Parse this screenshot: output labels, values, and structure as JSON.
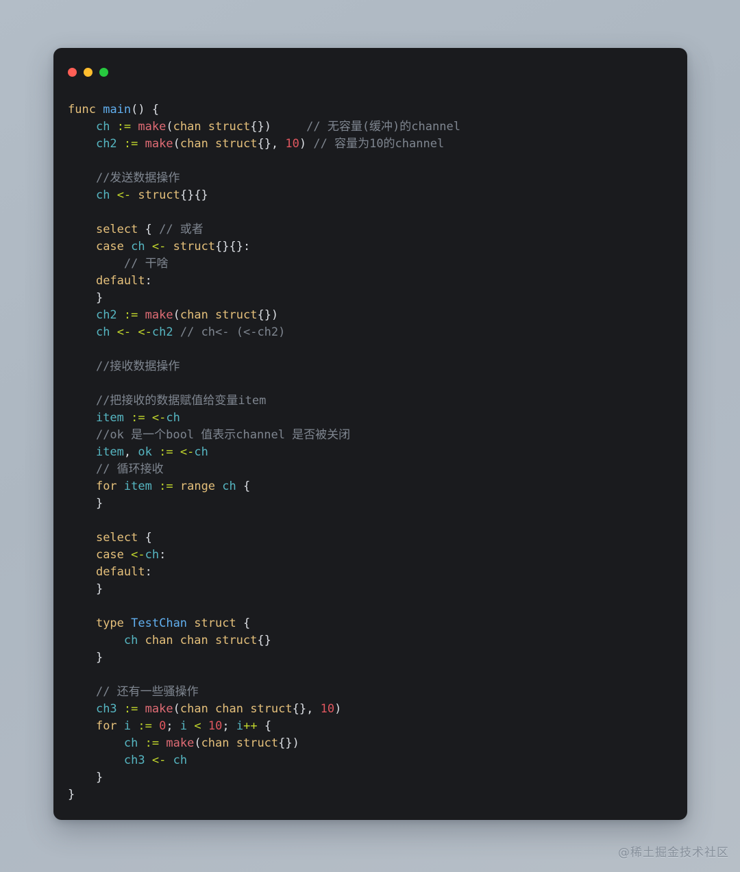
{
  "window": {
    "title_bar": {
      "buttons": [
        {
          "name": "close",
          "color": "#ff5f56",
          "label": ""
        },
        {
          "name": "minimize",
          "color": "#ffbd2e",
          "label": ""
        },
        {
          "name": "maximize",
          "color": "#27c93f",
          "label": ""
        }
      ]
    },
    "background": "#1a1b1e"
  },
  "theme": {
    "keyword": "#e5c07b",
    "function": "#61afef",
    "variable": "#56b6c2",
    "operator": "#c3d82c",
    "builtin": "#e06c75",
    "type": "#e5c07b",
    "number": "#e0575f",
    "punctuation": "#dcdfe4",
    "comment": "#7f8690",
    "page_background": "#b1bbc5"
  },
  "code": {
    "language": "go",
    "lines": [
      {
        "n": 1,
        "text": "func main() {"
      },
      {
        "n": 2,
        "text": "    ch := make(chan struct{})     // 无容量(缓冲)的channel"
      },
      {
        "n": 3,
        "text": "    ch2 := make(chan struct{}, 10) // 容量为10的channel"
      },
      {
        "n": 4,
        "text": ""
      },
      {
        "n": 5,
        "text": "    //发送数据操作"
      },
      {
        "n": 6,
        "text": "    ch <- struct{}{}"
      },
      {
        "n": 7,
        "text": ""
      },
      {
        "n": 8,
        "text": "    select { // 或者"
      },
      {
        "n": 9,
        "text": "    case ch <- struct{}{}:"
      },
      {
        "n": 10,
        "text": "        // 干啥"
      },
      {
        "n": 11,
        "text": "    default:"
      },
      {
        "n": 12,
        "text": "    }"
      },
      {
        "n": 13,
        "text": "    ch2 := make(chan struct{})"
      },
      {
        "n": 14,
        "text": "    ch <- <-ch2 // ch<- (<-ch2)"
      },
      {
        "n": 15,
        "text": ""
      },
      {
        "n": 16,
        "text": "    //接收数据操作"
      },
      {
        "n": 17,
        "text": ""
      },
      {
        "n": 18,
        "text": "    //把接收的数据赋值给变量item"
      },
      {
        "n": 19,
        "text": "    item := <-ch"
      },
      {
        "n": 20,
        "text": "    //ok 是一个bool 值表示channel 是否被关闭"
      },
      {
        "n": 21,
        "text": "    item, ok := <-ch"
      },
      {
        "n": 22,
        "text": "    // 循环接收"
      },
      {
        "n": 23,
        "text": "    for item := range ch {"
      },
      {
        "n": 24,
        "text": "    }"
      },
      {
        "n": 25,
        "text": ""
      },
      {
        "n": 26,
        "text": "    select {"
      },
      {
        "n": 27,
        "text": "    case <-ch:"
      },
      {
        "n": 28,
        "text": "    default:"
      },
      {
        "n": 29,
        "text": "    }"
      },
      {
        "n": 30,
        "text": ""
      },
      {
        "n": 31,
        "text": "    type TestChan struct {"
      },
      {
        "n": 32,
        "text": "        ch chan chan struct{}"
      },
      {
        "n": 33,
        "text": "    }"
      },
      {
        "n": 34,
        "text": ""
      },
      {
        "n": 35,
        "text": "    // 还有一些骚操作"
      },
      {
        "n": 36,
        "text": "    ch3 := make(chan chan struct{}, 10)"
      },
      {
        "n": 37,
        "text": "    for i := 0; i < 10; i++ {"
      },
      {
        "n": 38,
        "text": "        ch := make(chan struct{})"
      },
      {
        "n": 39,
        "text": "        ch3 <- ch"
      },
      {
        "n": 40,
        "text": "    }"
      },
      {
        "n": 41,
        "text": "}"
      }
    ],
    "tokens": {
      "l1": [
        [
          "kw",
          "func"
        ],
        [
          "pun",
          " "
        ],
        [
          "fn",
          "main"
        ],
        [
          "pun",
          "() {"
        ]
      ],
      "l2": [
        [
          "pun",
          "    "
        ],
        [
          "var",
          "ch"
        ],
        [
          "pun",
          " "
        ],
        [
          "op",
          ":="
        ],
        [
          "pun",
          " "
        ],
        [
          "bi",
          "make"
        ],
        [
          "pun",
          "("
        ],
        [
          "ty",
          "chan struct"
        ],
        [
          "pun",
          "{})"
        ],
        [
          "cm",
          "     // 无容量(缓冲)的channel"
        ]
      ],
      "l3": [
        [
          "pun",
          "    "
        ],
        [
          "var",
          "ch2"
        ],
        [
          "pun",
          " "
        ],
        [
          "op",
          ":="
        ],
        [
          "pun",
          " "
        ],
        [
          "bi",
          "make"
        ],
        [
          "pun",
          "("
        ],
        [
          "ty",
          "chan struct"
        ],
        [
          "pun",
          "{}, "
        ],
        [
          "num",
          "10"
        ],
        [
          "pun",
          ")"
        ],
        [
          "cm",
          " // 容量为10的channel"
        ]
      ],
      "l5": [
        [
          "pun",
          "    "
        ],
        [
          "cm",
          "//发送数据操作"
        ]
      ],
      "l6": [
        [
          "pun",
          "    "
        ],
        [
          "var",
          "ch"
        ],
        [
          "pun",
          " "
        ],
        [
          "op",
          "<-"
        ],
        [
          "pun",
          " "
        ],
        [
          "ty",
          "struct"
        ],
        [
          "pun",
          "{}{}"
        ]
      ],
      "l8": [
        [
          "pun",
          "    "
        ],
        [
          "kw",
          "select"
        ],
        [
          "pun",
          " {"
        ],
        [
          "cm",
          " // 或者"
        ]
      ],
      "l9": [
        [
          "pun",
          "    "
        ],
        [
          "kw",
          "case"
        ],
        [
          "pun",
          " "
        ],
        [
          "var",
          "ch"
        ],
        [
          "pun",
          " "
        ],
        [
          "op",
          "<-"
        ],
        [
          "pun",
          " "
        ],
        [
          "ty",
          "struct"
        ],
        [
          "pun",
          "{}{}:"
        ]
      ],
      "l10": [
        [
          "pun",
          "        "
        ],
        [
          "cm",
          "// 干啥"
        ]
      ],
      "l11": [
        [
          "pun",
          "    "
        ],
        [
          "kw",
          "default"
        ],
        [
          "pun",
          ":"
        ]
      ],
      "l12": [
        [
          "pun",
          "    }"
        ]
      ],
      "l13": [
        [
          "pun",
          "    "
        ],
        [
          "var",
          "ch2"
        ],
        [
          "pun",
          " "
        ],
        [
          "op",
          ":="
        ],
        [
          "pun",
          " "
        ],
        [
          "bi",
          "make"
        ],
        [
          "pun",
          "("
        ],
        [
          "ty",
          "chan struct"
        ],
        [
          "pun",
          "{})"
        ]
      ],
      "l14": [
        [
          "pun",
          "    "
        ],
        [
          "var",
          "ch"
        ],
        [
          "pun",
          " "
        ],
        [
          "op",
          "<-"
        ],
        [
          "pun",
          " "
        ],
        [
          "op",
          "<-"
        ],
        [
          "var",
          "ch2"
        ],
        [
          "cm",
          " // ch<- (<-ch2)"
        ]
      ],
      "l16": [
        [
          "pun",
          "    "
        ],
        [
          "cm",
          "//接收数据操作"
        ]
      ],
      "l18": [
        [
          "pun",
          "    "
        ],
        [
          "cm",
          "//把接收的数据赋值给变量item"
        ]
      ],
      "l19": [
        [
          "pun",
          "    "
        ],
        [
          "var",
          "item"
        ],
        [
          "pun",
          " "
        ],
        [
          "op",
          ":="
        ],
        [
          "pun",
          " "
        ],
        [
          "op",
          "<-"
        ],
        [
          "var",
          "ch"
        ]
      ],
      "l20": [
        [
          "pun",
          "    "
        ],
        [
          "cm",
          "//ok 是一个bool 值表示channel 是否被关闭"
        ]
      ],
      "l21": [
        [
          "pun",
          "    "
        ],
        [
          "var",
          "item"
        ],
        [
          "pun",
          ", "
        ],
        [
          "var",
          "ok"
        ],
        [
          "pun",
          " "
        ],
        [
          "op",
          ":="
        ],
        [
          "pun",
          " "
        ],
        [
          "op",
          "<-"
        ],
        [
          "var",
          "ch"
        ]
      ],
      "l22": [
        [
          "pun",
          "    "
        ],
        [
          "cm",
          "// 循环接收"
        ]
      ],
      "l23": [
        [
          "pun",
          "    "
        ],
        [
          "kw",
          "for"
        ],
        [
          "pun",
          " "
        ],
        [
          "var",
          "item"
        ],
        [
          "pun",
          " "
        ],
        [
          "op",
          ":="
        ],
        [
          "pun",
          " "
        ],
        [
          "kw",
          "range"
        ],
        [
          "pun",
          " "
        ],
        [
          "var",
          "ch"
        ],
        [
          "pun",
          " {"
        ]
      ],
      "l24": [
        [
          "pun",
          "    }"
        ]
      ],
      "l26": [
        [
          "pun",
          "    "
        ],
        [
          "kw",
          "select"
        ],
        [
          "pun",
          " {"
        ]
      ],
      "l27": [
        [
          "pun",
          "    "
        ],
        [
          "kw",
          "case"
        ],
        [
          "pun",
          " "
        ],
        [
          "op",
          "<-"
        ],
        [
          "var",
          "ch"
        ],
        [
          "pun",
          ":"
        ]
      ],
      "l28": [
        [
          "pun",
          "    "
        ],
        [
          "kw",
          "default"
        ],
        [
          "pun",
          ":"
        ]
      ],
      "l29": [
        [
          "pun",
          "    }"
        ]
      ],
      "l31": [
        [
          "pun",
          "    "
        ],
        [
          "kw",
          "type"
        ],
        [
          "pun",
          " "
        ],
        [
          "fn",
          "TestChan"
        ],
        [
          "pun",
          " "
        ],
        [
          "ty",
          "struct"
        ],
        [
          "pun",
          " {"
        ]
      ],
      "l32": [
        [
          "pun",
          "        "
        ],
        [
          "var",
          "ch"
        ],
        [
          "pun",
          " "
        ],
        [
          "ty",
          "chan chan struct"
        ],
        [
          "pun",
          "{}"
        ]
      ],
      "l33": [
        [
          "pun",
          "    }"
        ]
      ],
      "l35": [
        [
          "pun",
          "    "
        ],
        [
          "cm",
          "// 还有一些骚操作"
        ]
      ],
      "l36": [
        [
          "pun",
          "    "
        ],
        [
          "var",
          "ch3"
        ],
        [
          "pun",
          " "
        ],
        [
          "op",
          ":="
        ],
        [
          "pun",
          " "
        ],
        [
          "bi",
          "make"
        ],
        [
          "pun",
          "("
        ],
        [
          "ty",
          "chan chan struct"
        ],
        [
          "pun",
          "{}, "
        ],
        [
          "num",
          "10"
        ],
        [
          "pun",
          ")"
        ]
      ],
      "l37": [
        [
          "pun",
          "    "
        ],
        [
          "kw",
          "for"
        ],
        [
          "pun",
          " "
        ],
        [
          "var",
          "i"
        ],
        [
          "pun",
          " "
        ],
        [
          "op",
          ":="
        ],
        [
          "pun",
          " "
        ],
        [
          "num",
          "0"
        ],
        [
          "pun",
          "; "
        ],
        [
          "var",
          "i"
        ],
        [
          "pun",
          " "
        ],
        [
          "op",
          "<"
        ],
        [
          "pun",
          " "
        ],
        [
          "num",
          "10"
        ],
        [
          "pun",
          "; "
        ],
        [
          "var",
          "i"
        ],
        [
          "op",
          "++"
        ],
        [
          "pun",
          " {"
        ]
      ],
      "l38": [
        [
          "pun",
          "        "
        ],
        [
          "var",
          "ch"
        ],
        [
          "pun",
          " "
        ],
        [
          "op",
          ":="
        ],
        [
          "pun",
          " "
        ],
        [
          "bi",
          "make"
        ],
        [
          "pun",
          "("
        ],
        [
          "ty",
          "chan struct"
        ],
        [
          "pun",
          "{})"
        ]
      ],
      "l39": [
        [
          "pun",
          "        "
        ],
        [
          "var",
          "ch3"
        ],
        [
          "pun",
          " "
        ],
        [
          "op",
          "<-"
        ],
        [
          "pun",
          " "
        ],
        [
          "var",
          "ch"
        ]
      ],
      "l40": [
        [
          "pun",
          "    }"
        ]
      ],
      "l41": [
        [
          "pun",
          "}"
        ]
      ]
    }
  },
  "watermark": {
    "text": "@稀土掘金技术社区"
  }
}
